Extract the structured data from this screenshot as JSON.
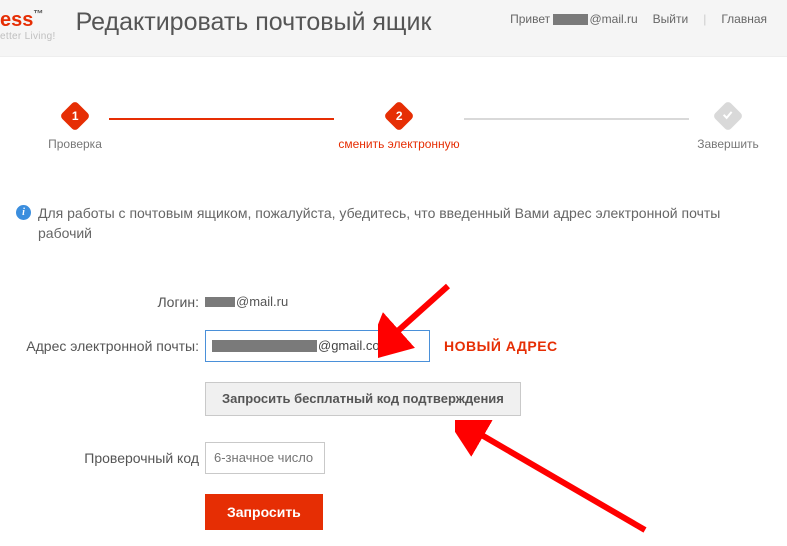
{
  "header": {
    "logo_text": "ess",
    "logo_tm": "™",
    "tagline": "etter Living!",
    "page_title": "Редактировать почтовый ящик",
    "greeting": "Привет",
    "user_domain": "@mail.ru",
    "link_logout": "Выйти",
    "link_home": "Главная"
  },
  "steps": {
    "s1": {
      "num": "1",
      "label": "Проверка"
    },
    "s2": {
      "num": "2",
      "label": "сменить электронную"
    },
    "s3": {
      "label": "Завершить"
    }
  },
  "info": {
    "text": "Для работы с почтовым ящиком, пожалуйста, убедитесь, что введенный Вами адрес электронной почты рабочий"
  },
  "form": {
    "login_label": "Логин:",
    "login_domain": "@mail.ru",
    "email_label": "Адрес электронной почты:",
    "email_domain": "@gmail.cor",
    "email_annotation": "НОВЫЙ АДРЕС",
    "request_code_btn": "Запросить бесплатный код подтверждения",
    "code_label": "Проверочный код",
    "code_placeholder": "6-значное число",
    "submit_btn": "Запросить"
  }
}
